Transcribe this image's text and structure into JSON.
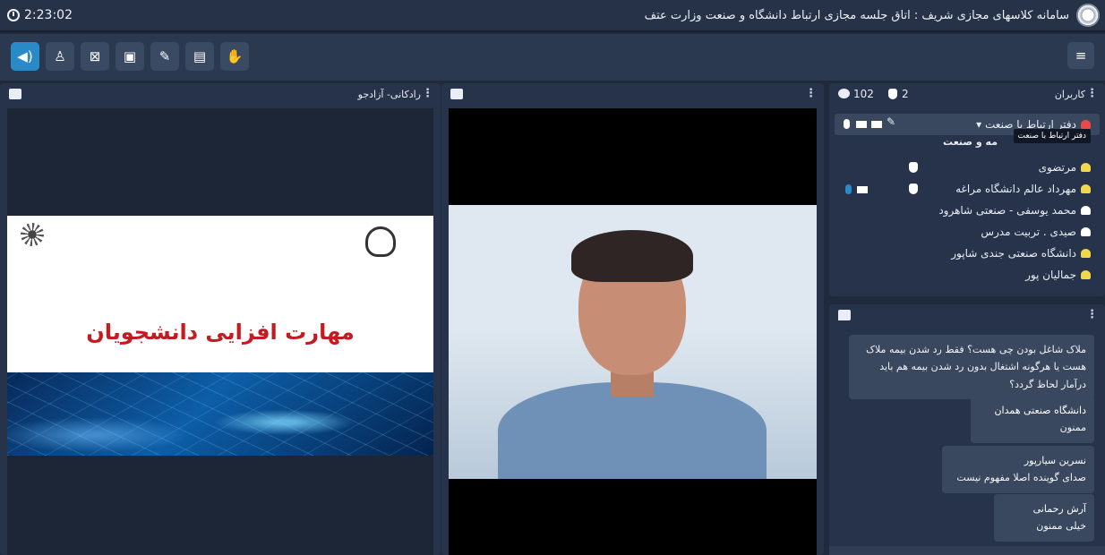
{
  "titlebar": {
    "time": "2:23:02",
    "title": "سامانه کلاسهای مجازی شریف : اتاق جلسه مجازی ارتباط دانشگاه و صنعت وزارت عتف"
  },
  "icons": {
    "speaker": "speaker-icon",
    "mic": "microphone-muted-icon",
    "camera": "camera-off-icon",
    "screen": "screen-share-icon",
    "brush": "brush-icon",
    "folder": "folder-icon",
    "hand": "raise-hand-icon",
    "menu": "menu-icon"
  },
  "presentation": {
    "header": "رادکانی- آزادجو",
    "slide_title": "مهارت افزایی دانشجویان"
  },
  "users_panel": {
    "title": "کاربران",
    "count": "102",
    "hands": "2",
    "tooltip": "دفتر ارتباط با صنعت",
    "hidden_text": "مه و صنعت",
    "users": [
      {
        "name": "دفتر ارتباط با صنعت ▾",
        "color": "#e64a4a"
      },
      {
        "name": "مرتضوی",
        "color": "#f1d84a"
      },
      {
        "name": "مهرداد عالم دانشگاه مراغه",
        "color": "#f1d84a"
      },
      {
        "name": "محمد یوسفی - صنعتی شاهرود",
        "color": "#ffffff"
      },
      {
        "name": "صیدی . تربیت مدرس",
        "color": "#ffffff"
      },
      {
        "name": "دانشگاه صنعتی جندی شاپور",
        "color": "#f1d84a"
      },
      {
        "name": "جمالیان پور",
        "color": "#f1d84a"
      }
    ]
  },
  "chat": {
    "messages": [
      {
        "text": "ملاک شاغل بودن چی هست؟ فقط رد شدن بیمه ملاک هست یا هرگونه اشتغال بدون رد شدن بیمه هم باید درآمار لحاظ گردد؟"
      },
      {
        "sender": "دانشگاه صنعتی همدان",
        "text": "ممنون"
      },
      {
        "sender": "نسرین سیارپور",
        "text": "صدای گوینده اصلا مفهوم نیست"
      },
      {
        "sender": "آرش رحمانی",
        "text": "خیلی ممنون"
      }
    ]
  }
}
